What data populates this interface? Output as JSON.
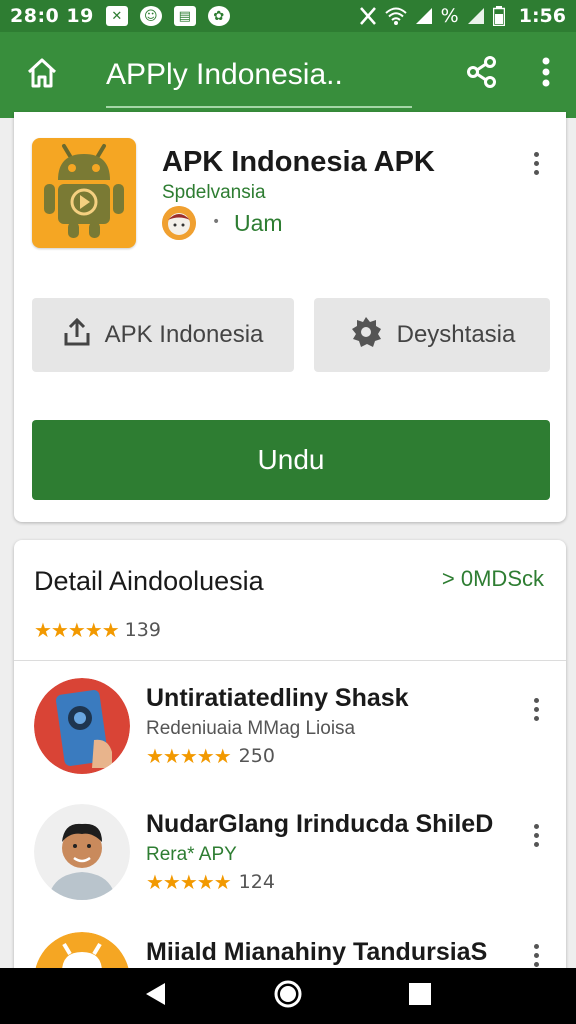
{
  "status_bar": {
    "time_left": "28:0 19",
    "time_right": "1:56",
    "battery_text": "%"
  },
  "app_bar": {
    "title": "APPly Indonesia.."
  },
  "app_card": {
    "name": "APK Indonesia APK",
    "developer": "Spdelvansia",
    "meta": "Uam",
    "dot": "•",
    "share_button": "APK Indonesia",
    "developer_button": "Deyshtasia",
    "install_button": "Undu"
  },
  "detail_section": {
    "title": "Detail Aindooluesia",
    "link": "> 0MDSck",
    "stars": "★★★★★",
    "rating_count": "139",
    "items": [
      {
        "title": "Untiratiatedliny Shask",
        "subtitle": "Redeniuaia MMag Lioisa",
        "stars": "★★★★★",
        "rating_count": "250"
      },
      {
        "title": "NudarGlang Irinducda ShileD",
        "subtitle": "Rera* APY",
        "stars": "★★★★★",
        "rating_count": "124"
      },
      {
        "title": "Miiald Mianahiny TandursiaS",
        "subtitle": "",
        "stars": "",
        "rating_count": ""
      }
    ]
  },
  "colors": {
    "status_bar": "#2e7d32",
    "app_bar": "#388e3c",
    "accent_green": "#2e7d32",
    "star": "#f29900",
    "app_icon_bg": "#f5a623"
  },
  "icons": {
    "home": "home-icon",
    "share": "share-icon",
    "more": "more-vert-icon",
    "upload": "upload-icon",
    "gear": "gear-icon",
    "back": "back-icon",
    "nav_home": "circle-home-icon",
    "recents": "square-recents-icon"
  }
}
